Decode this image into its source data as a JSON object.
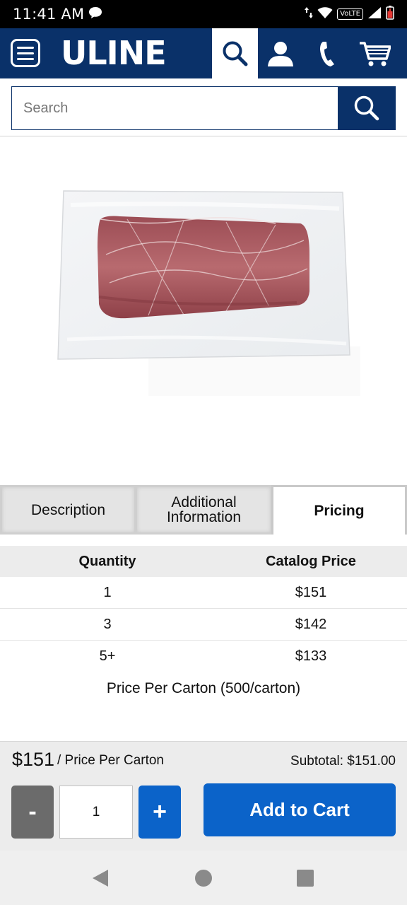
{
  "status_bar": {
    "time": "11:41 AM",
    "volte": "VoLTE",
    "icons": [
      "chat-bubble-icon",
      "data-arrows-icon",
      "wifi-icon",
      "signal-icon",
      "battery-icon"
    ]
  },
  "header": {
    "logo": "ULINE",
    "icons": [
      "menu-icon",
      "search-icon",
      "account-icon",
      "phone-icon",
      "cart-icon"
    ],
    "brand_color": "#0a3169"
  },
  "search": {
    "placeholder": "Search"
  },
  "product": {
    "image": "vacuum-sealed-meat-bag"
  },
  "tabs": [
    {
      "label": "Description",
      "active": false
    },
    {
      "label": "Additional Information",
      "active": false
    },
    {
      "label": "Pricing",
      "active": true
    }
  ],
  "pricing": {
    "headers": {
      "quantity": "Quantity",
      "price": "Catalog Price"
    },
    "rows": [
      {
        "quantity": "1",
        "price": "$151"
      },
      {
        "quantity": "3",
        "price": "$142"
      },
      {
        "quantity": "5+",
        "price": "$133"
      }
    ],
    "note": "Price Per Carton (500/carton)"
  },
  "purchase": {
    "unit_price": "$151",
    "unit_label": "/ Price Per Carton",
    "subtotal": "Subtotal: $151.00",
    "minus_label": "-",
    "quantity": "1",
    "plus_label": "+",
    "add_to_cart_label": "Add to Cart",
    "accent_color": "#0b63c9"
  },
  "nav_bar": {
    "icons": [
      "back-icon",
      "home-icon",
      "recents-icon"
    ]
  }
}
